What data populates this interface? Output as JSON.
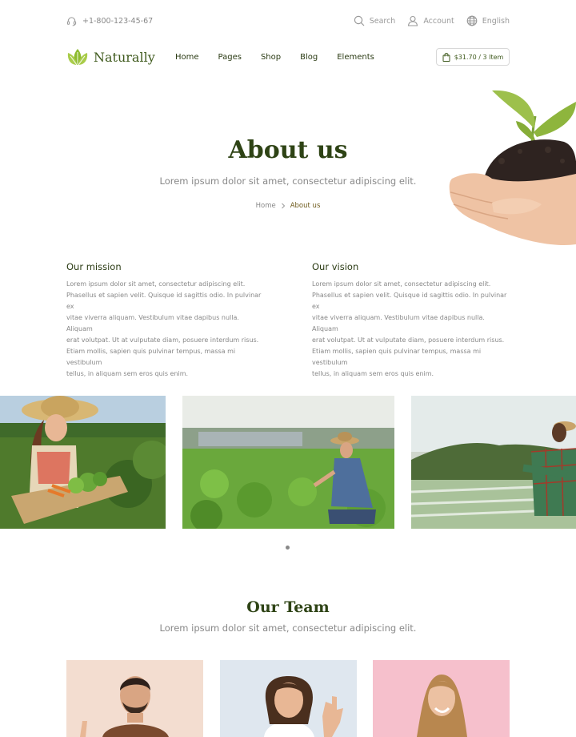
{
  "topbar": {
    "phone": "+1-800-123-45-67",
    "links": [
      {
        "label": "Search",
        "icon": "search-icon"
      },
      {
        "label": "Account",
        "icon": "user-icon"
      },
      {
        "label": "English",
        "icon": "globe-icon"
      }
    ]
  },
  "header": {
    "logo_text": "Naturally",
    "nav": [
      "Home",
      "Pages",
      "Shop",
      "Blog",
      "Elements"
    ],
    "cart_label": "$31.70 / 3 Item"
  },
  "hero": {
    "title": "About us",
    "subtitle": "Lorem ipsum dolor sit amet, consectetur adipiscing elit.",
    "breadcrumb": {
      "home": "Home",
      "current": "About us"
    }
  },
  "mission": {
    "title": "Our mission",
    "lines": [
      "Lorem ipsum dolor sit amet, consectetur adipiscing elit.",
      "Phasellus et sapien velit. Quisque id sagittis odio. In pulvinar ex",
      "vitae viverra aliquam. Vestibulum vitae dapibus nulla. Aliquam",
      "erat volutpat. Ut at vulputate diam, posuere interdum risus.",
      "Etiam mollis, sapien quis pulvinar tempus, massa mi vestibulum",
      "tellus, in aliquam sem eros quis enim."
    ]
  },
  "vision": {
    "title": "Our vision",
    "lines": [
      "Lorem ipsum dolor sit amet, consectetur adipiscing elit.",
      "Phasellus et sapien velit. Quisque id sagittis odio. In pulvinar ex",
      "vitae viverra aliquam. Vestibulum vitae dapibus nulla. Aliquam",
      "erat volutpat. Ut at vulputate diam, posuere interdum risus.",
      "Etiam mollis, sapien quis pulvinar tempus, massa mi vestibulum",
      "tellus, in aliquam sem eros quis enim."
    ]
  },
  "team": {
    "title": "Our Team",
    "subtitle": "Lorem ipsum dolor sit amet, consectetur adipiscing elit."
  },
  "colors": {
    "brand_green": "#3f5a1d",
    "heading_green": "#2e4315",
    "accent_brown": "#6e5a1c",
    "text_gray": "#888888"
  }
}
